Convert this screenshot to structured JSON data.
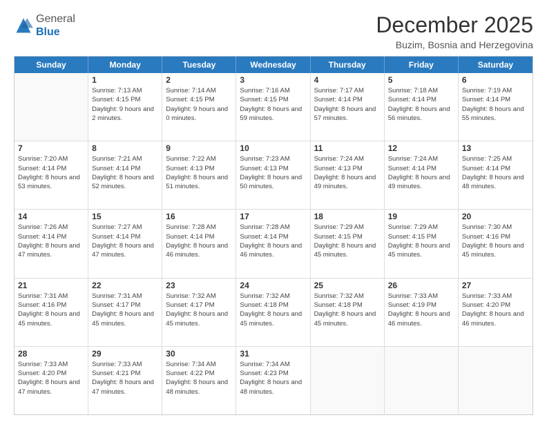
{
  "header": {
    "logo_general": "General",
    "logo_blue": "Blue",
    "month_title": "December 2025",
    "location": "Buzim, Bosnia and Herzegovina"
  },
  "calendar": {
    "days_of_week": [
      "Sunday",
      "Monday",
      "Tuesday",
      "Wednesday",
      "Thursday",
      "Friday",
      "Saturday"
    ],
    "weeks": [
      [
        {
          "day": "",
          "sunrise": "",
          "sunset": "",
          "daylight": ""
        },
        {
          "day": "1",
          "sunrise": "Sunrise: 7:13 AM",
          "sunset": "Sunset: 4:15 PM",
          "daylight": "Daylight: 9 hours and 2 minutes."
        },
        {
          "day": "2",
          "sunrise": "Sunrise: 7:14 AM",
          "sunset": "Sunset: 4:15 PM",
          "daylight": "Daylight: 9 hours and 0 minutes."
        },
        {
          "day": "3",
          "sunrise": "Sunrise: 7:16 AM",
          "sunset": "Sunset: 4:15 PM",
          "daylight": "Daylight: 8 hours and 59 minutes."
        },
        {
          "day": "4",
          "sunrise": "Sunrise: 7:17 AM",
          "sunset": "Sunset: 4:14 PM",
          "daylight": "Daylight: 8 hours and 57 minutes."
        },
        {
          "day": "5",
          "sunrise": "Sunrise: 7:18 AM",
          "sunset": "Sunset: 4:14 PM",
          "daylight": "Daylight: 8 hours and 56 minutes."
        },
        {
          "day": "6",
          "sunrise": "Sunrise: 7:19 AM",
          "sunset": "Sunset: 4:14 PM",
          "daylight": "Daylight: 8 hours and 55 minutes."
        }
      ],
      [
        {
          "day": "7",
          "sunrise": "Sunrise: 7:20 AM",
          "sunset": "Sunset: 4:14 PM",
          "daylight": "Daylight: 8 hours and 53 minutes."
        },
        {
          "day": "8",
          "sunrise": "Sunrise: 7:21 AM",
          "sunset": "Sunset: 4:14 PM",
          "daylight": "Daylight: 8 hours and 52 minutes."
        },
        {
          "day": "9",
          "sunrise": "Sunrise: 7:22 AM",
          "sunset": "Sunset: 4:13 PM",
          "daylight": "Daylight: 8 hours and 51 minutes."
        },
        {
          "day": "10",
          "sunrise": "Sunrise: 7:23 AM",
          "sunset": "Sunset: 4:13 PM",
          "daylight": "Daylight: 8 hours and 50 minutes."
        },
        {
          "day": "11",
          "sunrise": "Sunrise: 7:24 AM",
          "sunset": "Sunset: 4:13 PM",
          "daylight": "Daylight: 8 hours and 49 minutes."
        },
        {
          "day": "12",
          "sunrise": "Sunrise: 7:24 AM",
          "sunset": "Sunset: 4:14 PM",
          "daylight": "Daylight: 8 hours and 49 minutes."
        },
        {
          "day": "13",
          "sunrise": "Sunrise: 7:25 AM",
          "sunset": "Sunset: 4:14 PM",
          "daylight": "Daylight: 8 hours and 48 minutes."
        }
      ],
      [
        {
          "day": "14",
          "sunrise": "Sunrise: 7:26 AM",
          "sunset": "Sunset: 4:14 PM",
          "daylight": "Daylight: 8 hours and 47 minutes."
        },
        {
          "day": "15",
          "sunrise": "Sunrise: 7:27 AM",
          "sunset": "Sunset: 4:14 PM",
          "daylight": "Daylight: 8 hours and 47 minutes."
        },
        {
          "day": "16",
          "sunrise": "Sunrise: 7:28 AM",
          "sunset": "Sunset: 4:14 PM",
          "daylight": "Daylight: 8 hours and 46 minutes."
        },
        {
          "day": "17",
          "sunrise": "Sunrise: 7:28 AM",
          "sunset": "Sunset: 4:14 PM",
          "daylight": "Daylight: 8 hours and 46 minutes."
        },
        {
          "day": "18",
          "sunrise": "Sunrise: 7:29 AM",
          "sunset": "Sunset: 4:15 PM",
          "daylight": "Daylight: 8 hours and 45 minutes."
        },
        {
          "day": "19",
          "sunrise": "Sunrise: 7:29 AM",
          "sunset": "Sunset: 4:15 PM",
          "daylight": "Daylight: 8 hours and 45 minutes."
        },
        {
          "day": "20",
          "sunrise": "Sunrise: 7:30 AM",
          "sunset": "Sunset: 4:16 PM",
          "daylight": "Daylight: 8 hours and 45 minutes."
        }
      ],
      [
        {
          "day": "21",
          "sunrise": "Sunrise: 7:31 AM",
          "sunset": "Sunset: 4:16 PM",
          "daylight": "Daylight: 8 hours and 45 minutes."
        },
        {
          "day": "22",
          "sunrise": "Sunrise: 7:31 AM",
          "sunset": "Sunset: 4:17 PM",
          "daylight": "Daylight: 8 hours and 45 minutes."
        },
        {
          "day": "23",
          "sunrise": "Sunrise: 7:32 AM",
          "sunset": "Sunset: 4:17 PM",
          "daylight": "Daylight: 8 hours and 45 minutes."
        },
        {
          "day": "24",
          "sunrise": "Sunrise: 7:32 AM",
          "sunset": "Sunset: 4:18 PM",
          "daylight": "Daylight: 8 hours and 45 minutes."
        },
        {
          "day": "25",
          "sunrise": "Sunrise: 7:32 AM",
          "sunset": "Sunset: 4:18 PM",
          "daylight": "Daylight: 8 hours and 45 minutes."
        },
        {
          "day": "26",
          "sunrise": "Sunrise: 7:33 AM",
          "sunset": "Sunset: 4:19 PM",
          "daylight": "Daylight: 8 hours and 46 minutes."
        },
        {
          "day": "27",
          "sunrise": "Sunrise: 7:33 AM",
          "sunset": "Sunset: 4:20 PM",
          "daylight": "Daylight: 8 hours and 46 minutes."
        }
      ],
      [
        {
          "day": "28",
          "sunrise": "Sunrise: 7:33 AM",
          "sunset": "Sunset: 4:20 PM",
          "daylight": "Daylight: 8 hours and 47 minutes."
        },
        {
          "day": "29",
          "sunrise": "Sunrise: 7:33 AM",
          "sunset": "Sunset: 4:21 PM",
          "daylight": "Daylight: 8 hours and 47 minutes."
        },
        {
          "day": "30",
          "sunrise": "Sunrise: 7:34 AM",
          "sunset": "Sunset: 4:22 PM",
          "daylight": "Daylight: 8 hours and 48 minutes."
        },
        {
          "day": "31",
          "sunrise": "Sunrise: 7:34 AM",
          "sunset": "Sunset: 4:23 PM",
          "daylight": "Daylight: 8 hours and 48 minutes."
        },
        {
          "day": "",
          "sunrise": "",
          "sunset": "",
          "daylight": ""
        },
        {
          "day": "",
          "sunrise": "",
          "sunset": "",
          "daylight": ""
        },
        {
          "day": "",
          "sunrise": "",
          "sunset": "",
          "daylight": ""
        }
      ]
    ]
  }
}
